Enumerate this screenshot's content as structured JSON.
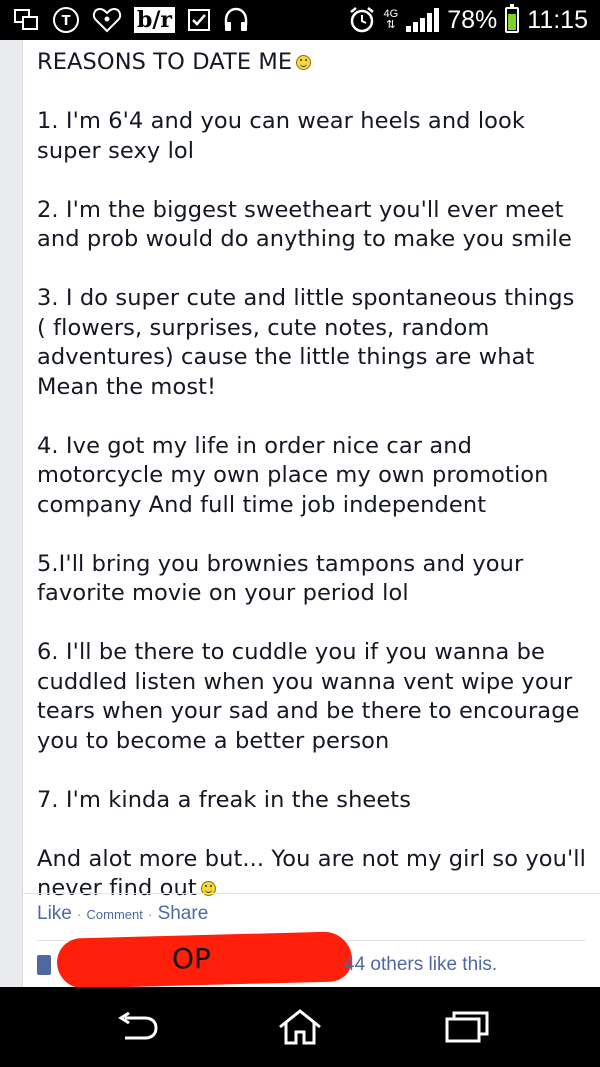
{
  "status_bar": {
    "network_type": "4G",
    "battery_percent": "78%",
    "battery_level": 0.78,
    "time": "11:15",
    "left_icons": [
      "copy-icon",
      "t-mobile-icon",
      "iheartradio-icon",
      "bleacher-report-icon",
      "checkbox-icon",
      "headphones-icon"
    ],
    "br_logo_text": "b/r"
  },
  "post": {
    "heading": "REASONS TO DATE ME",
    "paragraphs": [
      "1. I'm 6'4 and you can wear heels and look super sexy lol",
      "2. I'm the biggest sweetheart you'll ever meet and prob would do anything to make you smile",
      "3. I do super cute and little spontaneous things ( flowers, surprises, cute notes, random adventures) cause the little things are what Mean the most!",
      "4. Ive got my life in order nice car and motorcycle my own place my own promotion company And full time job independent",
      "5.I'll bring you brownies tampons and your favorite movie on your period lol",
      "6. I'll be there to cuddle you if you wanna be cuddled listen when you wanna vent wipe your tears when your sad and be there to encourage you to become a better person",
      "7. I'm kinda a freak in the sheets"
    ],
    "closing": "And alot more but... You are not my girl so you'll never find out"
  },
  "actions": {
    "like": "Like",
    "separator": "·",
    "comment": "Comment",
    "share": "Share"
  },
  "likes": {
    "redaction_label": "OP",
    "text": "44 others like this."
  },
  "colors": {
    "link": "#4e69a2",
    "text": "#141823",
    "redaction": "#ff1f0a"
  }
}
